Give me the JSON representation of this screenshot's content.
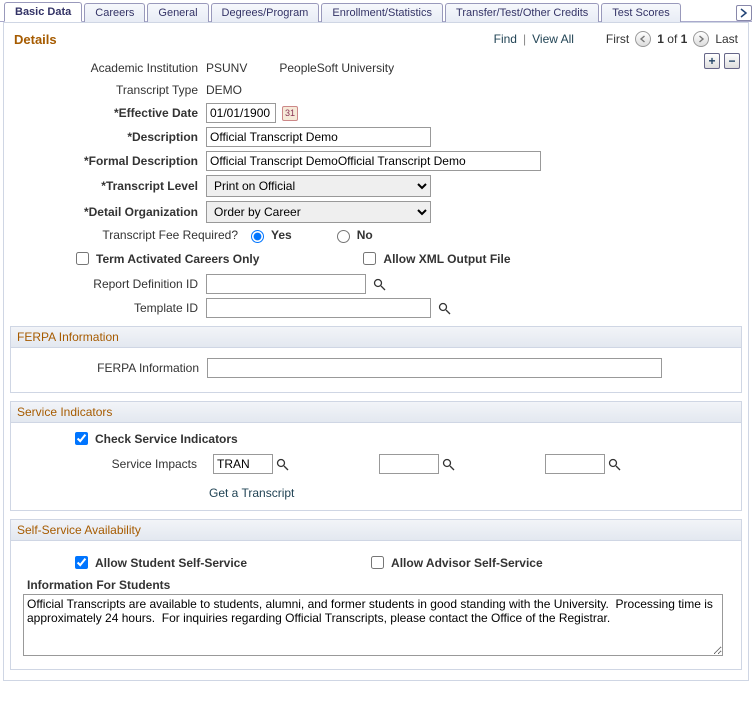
{
  "tabs": {
    "basic_data": "Basic Data",
    "careers": "Careers",
    "general": "General",
    "degrees": "Degrees/Program",
    "enrollment": "Enrollment/Statistics",
    "transfer": "Transfer/Test/Other Credits",
    "test_scores": "Test Scores"
  },
  "details": {
    "title": "Details",
    "find": "Find",
    "view_all": "View All",
    "first": "First",
    "count_prefix": "1",
    "count_of": " of ",
    "count_total": "1",
    "last": "Last"
  },
  "fields": {
    "academic_institution_label": "Academic Institution",
    "academic_institution_code": "PSUNV",
    "academic_institution_desc": "PeopleSoft University",
    "transcript_type_label": "Transcript Type",
    "transcript_type_value": "DEMO",
    "effective_date_label": "*Effective Date",
    "effective_date_value": "01/01/1900",
    "description_label": "*Description",
    "description_value": "Official Transcript Demo",
    "formal_desc_label": "*Formal Description",
    "formal_desc_value": "Official Transcript DemoOfficial Transcript Demo",
    "transcript_level_label": "*Transcript Level",
    "transcript_level_value": "Print on Official",
    "detail_org_label": "*Detail Organization",
    "detail_org_value": "Order by Career",
    "fee_label": "Transcript Fee Required?",
    "fee_yes": "Yes",
    "fee_no": "No",
    "term_act_label": "Term Activated Careers Only",
    "allow_xml_label": "Allow XML Output File",
    "report_def_label": "Report Definition ID",
    "report_def_value": "",
    "template_id_label": "Template ID",
    "template_id_value": ""
  },
  "ferpa": {
    "header": "FERPA Information",
    "field_label": "FERPA Information",
    "field_value": ""
  },
  "service": {
    "header": "Service Indicators",
    "check_label": "Check Service Indicators",
    "impacts_label": "Service Impacts",
    "impacts_value": "TRAN",
    "impacts2_value": "",
    "impacts3_value": "",
    "get_link": "Get a Transcript"
  },
  "selfservice": {
    "header": "Self-Service Availability",
    "allow_student_label": "Allow Student Self-Service",
    "allow_advisor_label": "Allow Advisor Self-Service",
    "info_label": "Information For Students",
    "info_value": "Official Transcripts are available to students, alumni, and former students in good standing with the University.  Processing time is approximately 24 hours.  For inquiries regarding Official Transcripts, please contact the Office of the Registrar."
  }
}
